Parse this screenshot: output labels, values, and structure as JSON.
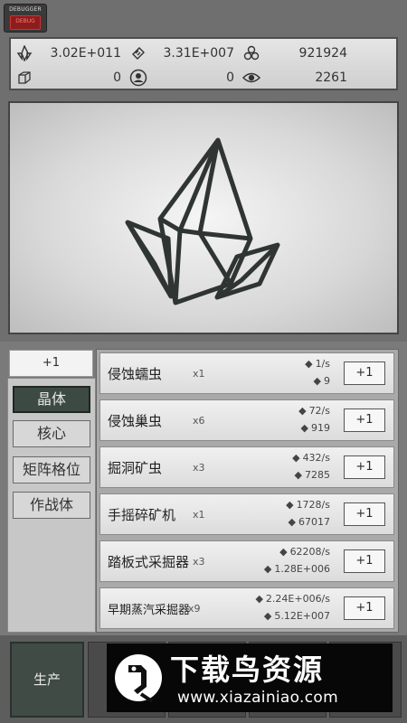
{
  "debugger": {
    "label": "DEBUGGER",
    "button": "DEBUG"
  },
  "stats": {
    "crystal": "3.02E+011",
    "core": "3.31E+007",
    "matrix": "921924",
    "box": "0",
    "unit": "0",
    "eye": "2261"
  },
  "tab_plus": "+1",
  "categories": [
    "晶体",
    "核心",
    "矩阵格位",
    "作战体"
  ],
  "items": [
    {
      "name": "侵蚀蠕虫",
      "count": "x1",
      "rate": "1/s",
      "cost": "9",
      "buy": "+1"
    },
    {
      "name": "侵蚀巢虫",
      "count": "x6",
      "rate": "72/s",
      "cost": "919",
      "buy": "+1"
    },
    {
      "name": "掘洞矿虫",
      "count": "x3",
      "rate": "432/s",
      "cost": "7285",
      "buy": "+1"
    },
    {
      "name": "手摇碎矿机",
      "count": "x1",
      "rate": "1728/s",
      "cost": "67017",
      "buy": "+1"
    },
    {
      "name": "踏板式采掘器",
      "count": "x3",
      "rate": "62208/s",
      "cost": "1.28E+006",
      "buy": "+1"
    },
    {
      "name": "早期蒸汽采掘器",
      "count": "x9",
      "rate": "2.24E+006/s",
      "cost": "5.12E+007",
      "buy": "+1"
    }
  ],
  "bottom_nav": {
    "produce": "生产"
  },
  "watermark": {
    "title": "下载鸟资源",
    "url": "www.xiazainiao.com"
  }
}
